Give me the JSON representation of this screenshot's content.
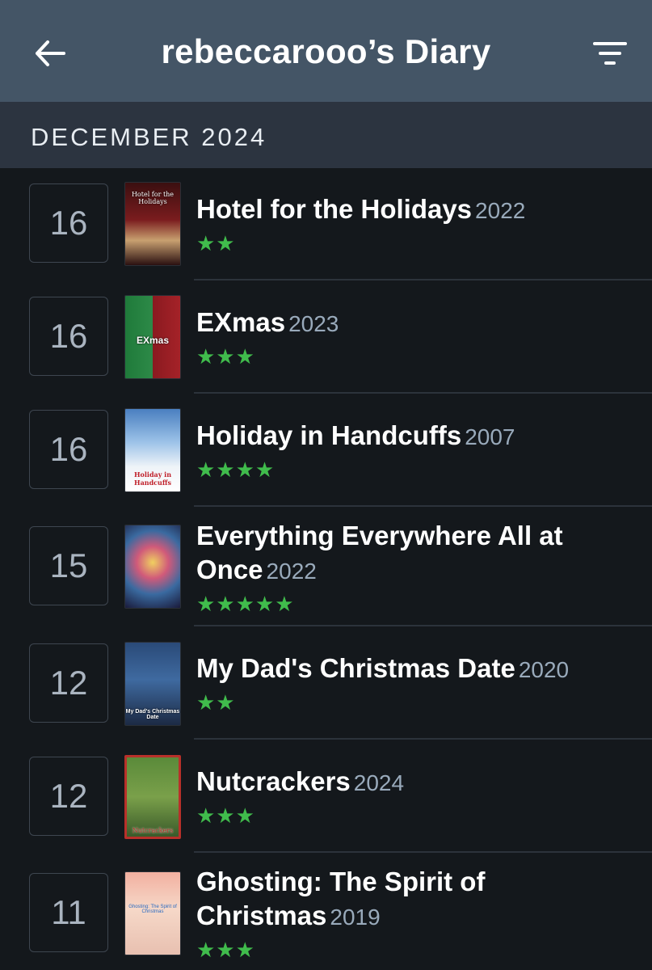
{
  "header": {
    "title": "rebeccarooo’s Diary",
    "back_icon": "arrow-left-icon",
    "filter_icon": "filter-icon"
  },
  "month_label": "DECEMBER 2024",
  "colors": {
    "header_bg": "#445566",
    "month_bg": "#2c3440",
    "page_bg": "#14181c",
    "star_green": "#40bc4c",
    "year_gray": "#99aabb"
  },
  "entries": [
    {
      "day": "16",
      "title": "Hotel for the Holidays",
      "year": "2022",
      "stars": "★★",
      "rating": 2,
      "poster_text": "Hotel for the Holidays"
    },
    {
      "day": "16",
      "title": "EXmas",
      "year": "2023",
      "stars": "★★★",
      "rating": 3,
      "poster_text": "EXmas"
    },
    {
      "day": "16",
      "title": "Holiday in Handcuffs",
      "year": "2007",
      "stars": "★★★★",
      "rating": 4,
      "poster_text": "Holiday in Handcuffs"
    },
    {
      "day": "15",
      "title": "Everything Everywhere All at Once",
      "year": "2022",
      "stars": "★★★★★",
      "rating": 5,
      "poster_text": ""
    },
    {
      "day": "12",
      "title": "My Dad's Christmas Date",
      "year": "2020",
      "stars": "★★",
      "rating": 2,
      "poster_text": "My Dad's Christmas Date"
    },
    {
      "day": "12",
      "title": "Nutcrackers",
      "year": "2024",
      "stars": "★★★",
      "rating": 3,
      "poster_text": "Nutcrackers"
    },
    {
      "day": "11",
      "title": "Ghosting: The Spirit of Christmas",
      "year": "2019",
      "stars": "★★★",
      "rating": 3,
      "poster_text": "Ghosting: The Spirit of Christmas"
    }
  ]
}
